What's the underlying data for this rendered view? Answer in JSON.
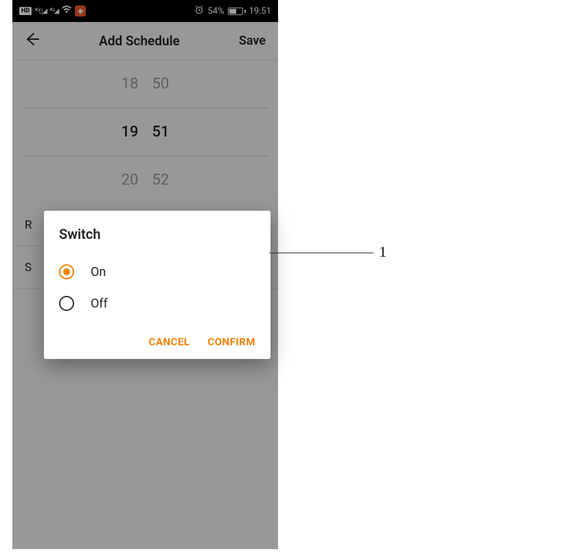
{
  "status": {
    "hd": "HD",
    "battery_pct": "54%",
    "time": "19:51"
  },
  "header": {
    "title": "Add Schedule",
    "save": "Save"
  },
  "picker": {
    "prev_h": "18",
    "prev_m": "50",
    "sel_h": "19",
    "sel_m": "51",
    "next_h": "20",
    "next_m": "52"
  },
  "rows": {
    "repeat": "R",
    "switch": "S"
  },
  "dialog": {
    "title": "Switch",
    "opt_on": "On",
    "opt_off": "Off",
    "cancel": "CANCEL",
    "confirm": "CONFIRM",
    "selected": "on"
  },
  "callout": {
    "label": "1"
  }
}
